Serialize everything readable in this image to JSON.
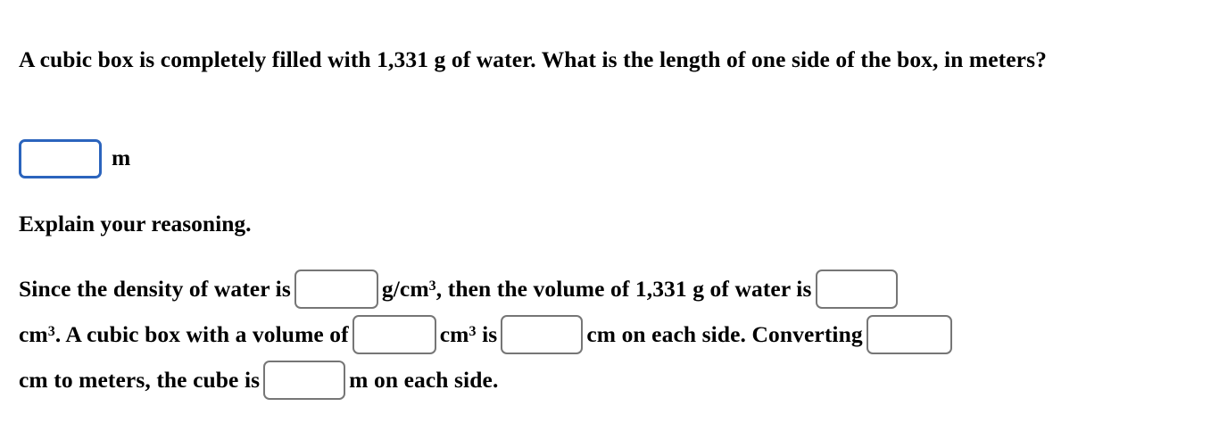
{
  "question": {
    "text": "A cubic box is completely filled with 1,331 g of water. What is the length of one side of the box, in meters?"
  },
  "answer": {
    "value": "",
    "placeholder": "",
    "unit_label": "m",
    "focus_border_color": "#2b64bd"
  },
  "explain": {
    "heading": "Explain your reasoning."
  },
  "reasoning": {
    "blank_border_color": "#767676",
    "seg1": "Since the density of water is",
    "blank1_value": "",
    "seg2_base": "g/cm",
    "seg2_sup": "3",
    "seg3": ", then the volume of 1,331 g of water is",
    "blank2_value": "",
    "seg4_base": "cm",
    "seg4_sup": "3",
    "seg5": ". A cubic box with a volume of",
    "blank3_value": "",
    "seg6_base": "cm",
    "seg6_sup": "3",
    "seg7": "is",
    "blank4_value": "",
    "seg8": "cm on each side. Converting",
    "blank5_value": "",
    "seg9": "cm to meters, the cube is",
    "blank6_value": "",
    "seg10": "m on each side."
  }
}
